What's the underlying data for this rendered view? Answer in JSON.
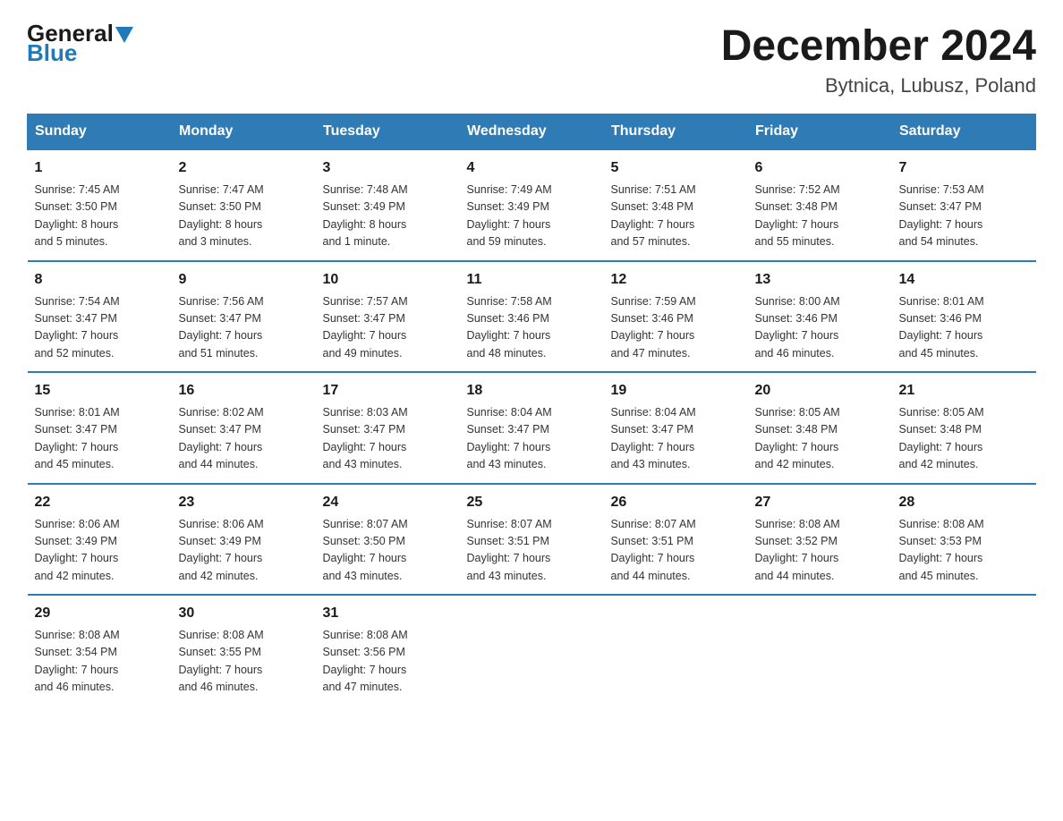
{
  "logo": {
    "line1": "General",
    "line2": "Blue"
  },
  "header": {
    "month": "December 2024",
    "location": "Bytnica, Lubusz, Poland"
  },
  "days_of_week": [
    "Sunday",
    "Monday",
    "Tuesday",
    "Wednesday",
    "Thursday",
    "Friday",
    "Saturday"
  ],
  "weeks": [
    [
      {
        "day": "1",
        "sunrise": "7:45 AM",
        "sunset": "3:50 PM",
        "daylight": "8 hours and 5 minutes."
      },
      {
        "day": "2",
        "sunrise": "7:47 AM",
        "sunset": "3:50 PM",
        "daylight": "8 hours and 3 minutes."
      },
      {
        "day": "3",
        "sunrise": "7:48 AM",
        "sunset": "3:49 PM",
        "daylight": "8 hours and 1 minute."
      },
      {
        "day": "4",
        "sunrise": "7:49 AM",
        "sunset": "3:49 PM",
        "daylight": "7 hours and 59 minutes."
      },
      {
        "day": "5",
        "sunrise": "7:51 AM",
        "sunset": "3:48 PM",
        "daylight": "7 hours and 57 minutes."
      },
      {
        "day": "6",
        "sunrise": "7:52 AM",
        "sunset": "3:48 PM",
        "daylight": "7 hours and 55 minutes."
      },
      {
        "day": "7",
        "sunrise": "7:53 AM",
        "sunset": "3:47 PM",
        "daylight": "7 hours and 54 minutes."
      }
    ],
    [
      {
        "day": "8",
        "sunrise": "7:54 AM",
        "sunset": "3:47 PM",
        "daylight": "7 hours and 52 minutes."
      },
      {
        "day": "9",
        "sunrise": "7:56 AM",
        "sunset": "3:47 PM",
        "daylight": "7 hours and 51 minutes."
      },
      {
        "day": "10",
        "sunrise": "7:57 AM",
        "sunset": "3:47 PM",
        "daylight": "7 hours and 49 minutes."
      },
      {
        "day": "11",
        "sunrise": "7:58 AM",
        "sunset": "3:46 PM",
        "daylight": "7 hours and 48 minutes."
      },
      {
        "day": "12",
        "sunrise": "7:59 AM",
        "sunset": "3:46 PM",
        "daylight": "7 hours and 47 minutes."
      },
      {
        "day": "13",
        "sunrise": "8:00 AM",
        "sunset": "3:46 PM",
        "daylight": "7 hours and 46 minutes."
      },
      {
        "day": "14",
        "sunrise": "8:01 AM",
        "sunset": "3:46 PM",
        "daylight": "7 hours and 45 minutes."
      }
    ],
    [
      {
        "day": "15",
        "sunrise": "8:01 AM",
        "sunset": "3:47 PM",
        "daylight": "7 hours and 45 minutes."
      },
      {
        "day": "16",
        "sunrise": "8:02 AM",
        "sunset": "3:47 PM",
        "daylight": "7 hours and 44 minutes."
      },
      {
        "day": "17",
        "sunrise": "8:03 AM",
        "sunset": "3:47 PM",
        "daylight": "7 hours and 43 minutes."
      },
      {
        "day": "18",
        "sunrise": "8:04 AM",
        "sunset": "3:47 PM",
        "daylight": "7 hours and 43 minutes."
      },
      {
        "day": "19",
        "sunrise": "8:04 AM",
        "sunset": "3:47 PM",
        "daylight": "7 hours and 43 minutes."
      },
      {
        "day": "20",
        "sunrise": "8:05 AM",
        "sunset": "3:48 PM",
        "daylight": "7 hours and 42 minutes."
      },
      {
        "day": "21",
        "sunrise": "8:05 AM",
        "sunset": "3:48 PM",
        "daylight": "7 hours and 42 minutes."
      }
    ],
    [
      {
        "day": "22",
        "sunrise": "8:06 AM",
        "sunset": "3:49 PM",
        "daylight": "7 hours and 42 minutes."
      },
      {
        "day": "23",
        "sunrise": "8:06 AM",
        "sunset": "3:49 PM",
        "daylight": "7 hours and 42 minutes."
      },
      {
        "day": "24",
        "sunrise": "8:07 AM",
        "sunset": "3:50 PM",
        "daylight": "7 hours and 43 minutes."
      },
      {
        "day": "25",
        "sunrise": "8:07 AM",
        "sunset": "3:51 PM",
        "daylight": "7 hours and 43 minutes."
      },
      {
        "day": "26",
        "sunrise": "8:07 AM",
        "sunset": "3:51 PM",
        "daylight": "7 hours and 44 minutes."
      },
      {
        "day": "27",
        "sunrise": "8:08 AM",
        "sunset": "3:52 PM",
        "daylight": "7 hours and 44 minutes."
      },
      {
        "day": "28",
        "sunrise": "8:08 AM",
        "sunset": "3:53 PM",
        "daylight": "7 hours and 45 minutes."
      }
    ],
    [
      {
        "day": "29",
        "sunrise": "8:08 AM",
        "sunset": "3:54 PM",
        "daylight": "7 hours and 46 minutes."
      },
      {
        "day": "30",
        "sunrise": "8:08 AM",
        "sunset": "3:55 PM",
        "daylight": "7 hours and 46 minutes."
      },
      {
        "day": "31",
        "sunrise": "8:08 AM",
        "sunset": "3:56 PM",
        "daylight": "7 hours and 47 minutes."
      },
      null,
      null,
      null,
      null
    ]
  ],
  "labels": {
    "sunrise": "Sunrise:",
    "sunset": "Sunset:",
    "daylight": "Daylight:"
  }
}
